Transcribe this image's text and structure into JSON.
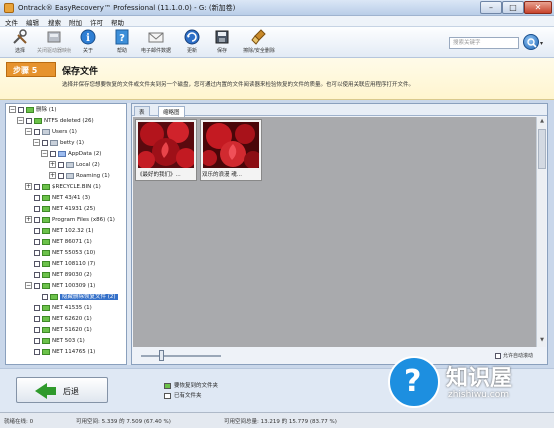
{
  "window": {
    "title": "Ontrack® EasyRecovery™ Professional (11.1.0.0) - G: (新加卷)"
  },
  "menu": [
    "文件",
    "编辑",
    "搜索",
    "附加",
    "许可",
    "帮助"
  ],
  "toolbar": {
    "buttons": [
      {
        "label": "选择",
        "icon": "tools-icon"
      },
      {
        "label": "关闭驱动器映射",
        "icon": "disk-icon"
      },
      {
        "label": "关于",
        "icon": "info-icon"
      },
      {
        "label": "帮助",
        "icon": "help-icon"
      },
      {
        "label": "电子邮件数据",
        "icon": "mail-icon"
      },
      {
        "label": "更新",
        "icon": "update-icon"
      },
      {
        "label": "保存",
        "icon": "save-icon"
      },
      {
        "label": "擦除/安全删除",
        "icon": "erase-icon"
      }
    ],
    "search_placeholder": "搜索关键字"
  },
  "step": {
    "badge": "步骤 5",
    "title": "保存文件",
    "description": "选择并保存您想要恢复的文件或文件夹到另一个磁盘，您可通过内置的文件阅读器来检验恢复的文件的质量。也可以使用关联应用程序打开文件。"
  },
  "tree": [
    {
      "label": "删除 (1)",
      "indent": 0,
      "toggle": "−",
      "folder": "green"
    },
    {
      "label": "NTFS deleted (26)",
      "indent": 1,
      "toggle": "−",
      "folder": "green"
    },
    {
      "label": "Users (1)",
      "indent": 2,
      "toggle": "−",
      "folder": "gray"
    },
    {
      "label": "betty (1)",
      "indent": 3,
      "toggle": "−",
      "folder": "gray"
    },
    {
      "label": "AppData (2)",
      "indent": 4,
      "toggle": "−",
      "folder": "blue"
    },
    {
      "label": "Local (2)",
      "indent": 5,
      "toggle": "+",
      "folder": "gray"
    },
    {
      "label": "Roaming (1)",
      "indent": 5,
      "toggle": "+",
      "folder": "gray"
    },
    {
      "label": "$RECYCLE.BIN (1)",
      "indent": 2,
      "toggle": "+",
      "folder": "green"
    },
    {
      "label": "NET 43/41 (3)",
      "indent": 2,
      "toggle": "",
      "folder": "green"
    },
    {
      "label": "NET 41931 (25)",
      "indent": 2,
      "toggle": "",
      "folder": "green"
    },
    {
      "label": "Program Files (x86) (1)",
      "indent": 2,
      "toggle": "+",
      "folder": "green"
    },
    {
      "label": "NET 102.32 (1)",
      "indent": 2,
      "toggle": "",
      "folder": "green"
    },
    {
      "label": "NET 86071 (1)",
      "indent": 2,
      "toggle": "",
      "folder": "green"
    },
    {
      "label": "NET 55053 (10)",
      "indent": 2,
      "toggle": "",
      "folder": "green"
    },
    {
      "label": "NET 108110 (7)",
      "indent": 2,
      "toggle": "",
      "folder": "green"
    },
    {
      "label": "NET 89030 (2)",
      "indent": 2,
      "toggle": "",
      "folder": "green"
    },
    {
      "label": "NET 100309 (1)",
      "indent": 2,
      "toggle": "−",
      "folder": "green"
    },
    {
      "label": "隐藏删除恢复文件 (2)",
      "indent": 3,
      "toggle": "",
      "folder": "green",
      "selected": true
    },
    {
      "label": "NET 41535 (1)",
      "indent": 2,
      "toggle": "",
      "folder": "green"
    },
    {
      "label": "NET 62620 (1)",
      "indent": 2,
      "toggle": "",
      "folder": "green"
    },
    {
      "label": "NET 51620 (1)",
      "indent": 2,
      "toggle": "",
      "folder": "green"
    },
    {
      "label": "NET 503 (1)",
      "indent": 2,
      "toggle": "",
      "folder": "green"
    },
    {
      "label": "NET 114765 (1)",
      "indent": 2,
      "toggle": "",
      "folder": "green"
    }
  ],
  "tabs": [
    "表",
    "缩略图"
  ],
  "thumbnails": [
    {
      "caption": "《最好的我们》..."
    },
    {
      "caption": "双乐的浪漫  魂..."
    }
  ],
  "slider": {
    "autoscroll_label": "允许自动滚动"
  },
  "bottom": {
    "back_label": "后退",
    "legend": [
      {
        "label": "要恢复到的文件夹",
        "color": "#6cc24a"
      },
      {
        "label": "已有文件夹",
        "color": "#ffffff"
      }
    ]
  },
  "status": {
    "left": "就绪在线: 0",
    "mid": "可用空间: 5.339 的 7.509 (67.40 %)",
    "right": "可用空间总量: 13.219 的 15.779 (83.77 %)"
  },
  "watermark": {
    "brand": "知识屋",
    "sub": "zhishiwu.com"
  },
  "colors": {
    "accent": "#e6932e",
    "selection": "#3470c9",
    "folder": "#6cc24a"
  }
}
